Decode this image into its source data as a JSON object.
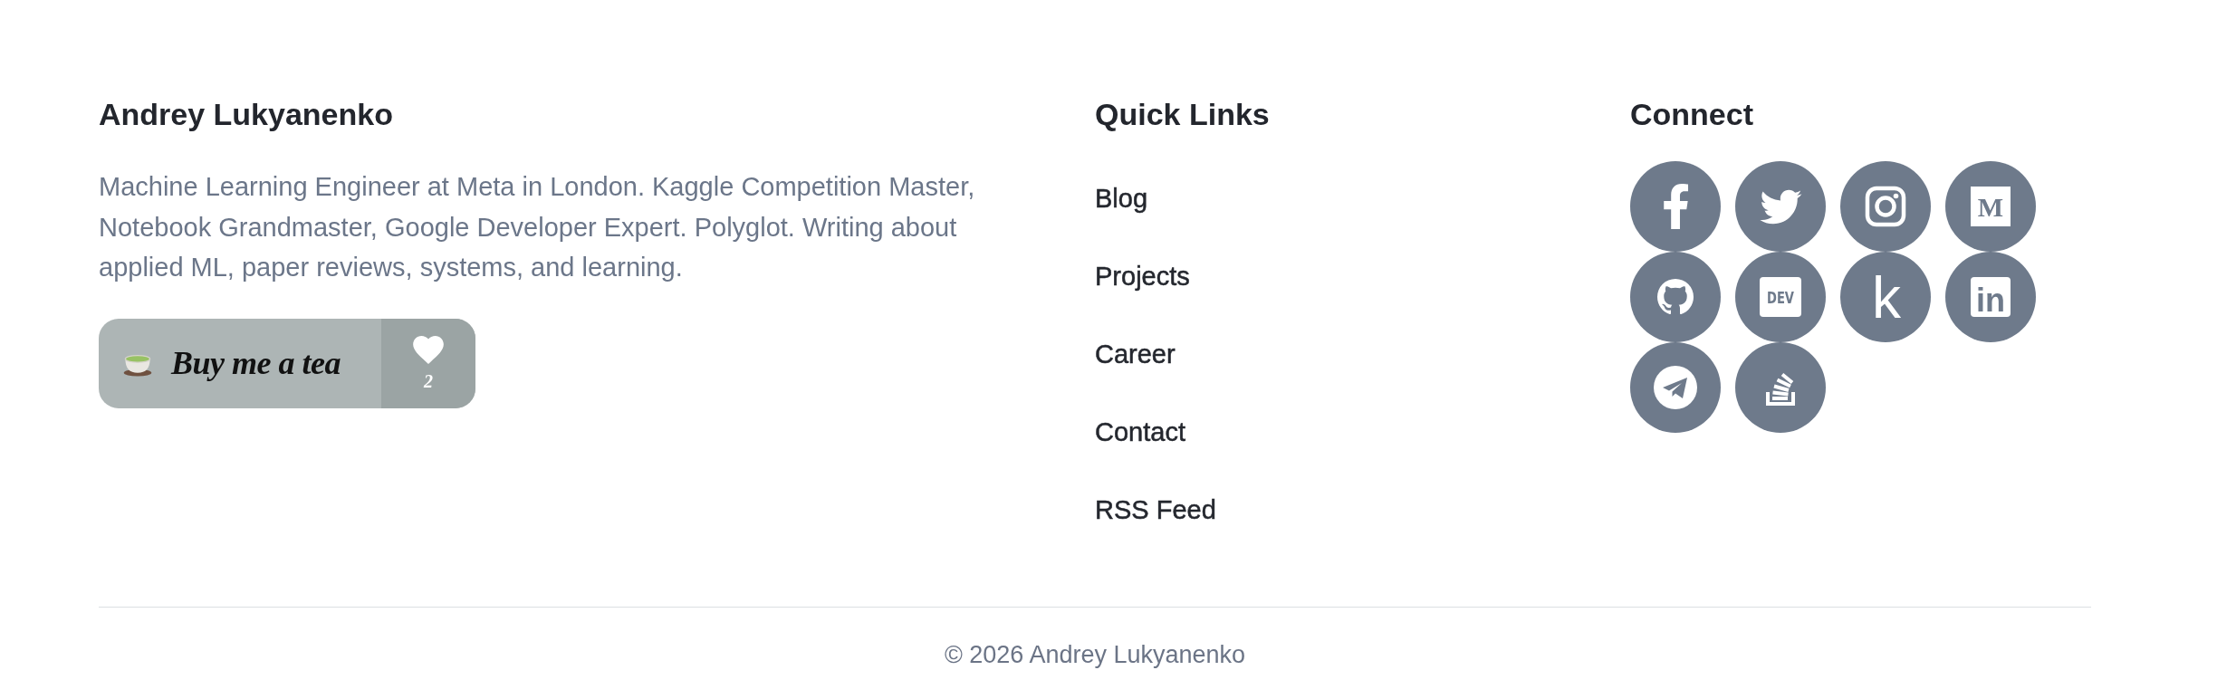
{
  "profile": {
    "name": "Andrey Lukyanenko",
    "bio": "Machine Learning Engineer at Meta in London. Kaggle Competition Master, Notebook Grandmaster, Google Developer Expert. Polyglot. Writing about applied ML, paper reviews, systems, and learning.",
    "tea_button": {
      "label": "Buy me a tea",
      "count": "2"
    }
  },
  "quick_links": {
    "title": "Quick Links",
    "links": [
      "Blog",
      "Projects",
      "Career",
      "Contact",
      "RSS Feed"
    ]
  },
  "connect": {
    "title": "Connect",
    "profiles": [
      {
        "kind": "facebook"
      },
      {
        "kind": "twitter"
      },
      {
        "kind": "instagram"
      },
      {
        "kind": "medium",
        "mark": "M"
      },
      {
        "kind": "github"
      },
      {
        "kind": "dev",
        "mark": "DEV"
      },
      {
        "kind": "kaggle",
        "mark": "k"
      },
      {
        "kind": "linkedin",
        "mark": "in"
      },
      {
        "kind": "telegram"
      },
      {
        "kind": "stackoverflow"
      }
    ]
  },
  "footer": {
    "copyright": "© 2026 Andrey Lukyanenko"
  }
}
